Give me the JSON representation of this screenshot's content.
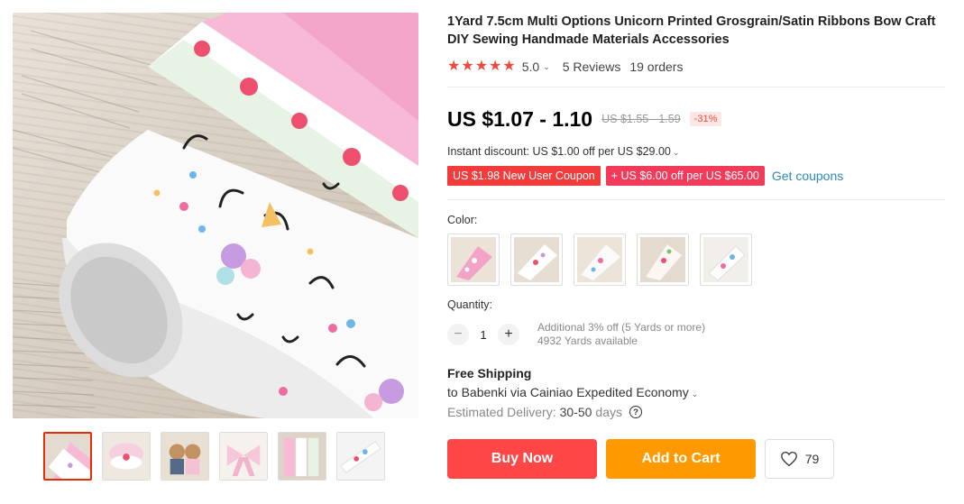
{
  "product": {
    "title": "1Yard 7.5cm Multi Options Unicorn Printed Grosgrain/Satin Ribbons Bow Craft DIY Sewing Handmade Materials Accessories",
    "rating": "5.0",
    "reviews": "5 Reviews",
    "orders": "19 orders"
  },
  "price": {
    "current": "US $1.07 - 1.10",
    "original": "US $1.55 - 1.59",
    "discount": "-31%"
  },
  "promo": {
    "instant_discount": "Instant discount: US $1.00 off per US $29.00",
    "coupon_new_user": "US $1.98 New User Coupon",
    "coupon_store": "+ US $6.00 off per US $65.00",
    "get_coupons": "Get coupons"
  },
  "options": {
    "color_label": "Color:",
    "color_count": 5
  },
  "quantity": {
    "label": "Quantity:",
    "value": "1",
    "note": "Additional 3% off (5 Yards or more)",
    "available": "4932 Yards available"
  },
  "shipping": {
    "title": "Free Shipping",
    "to": "to Babenki via Cainiao Expedited Economy",
    "delivery_label": "Estimated Delivery:",
    "delivery_value": "30-50",
    "delivery_unit": "days"
  },
  "actions": {
    "buy_now": "Buy Now",
    "add_to_cart": "Add to Cart",
    "wishlist_count": "79"
  },
  "icons": {
    "star": "star-icon",
    "caret": "chevron-down-icon",
    "minus": "minus-icon",
    "plus": "plus-icon",
    "help": "question-circle-icon",
    "heart": "heart-icon"
  },
  "colors": {
    "accent": "#ff4747",
    "cart": "#ff9900",
    "star": "#f04a3e",
    "link": "#2e8ab8"
  }
}
